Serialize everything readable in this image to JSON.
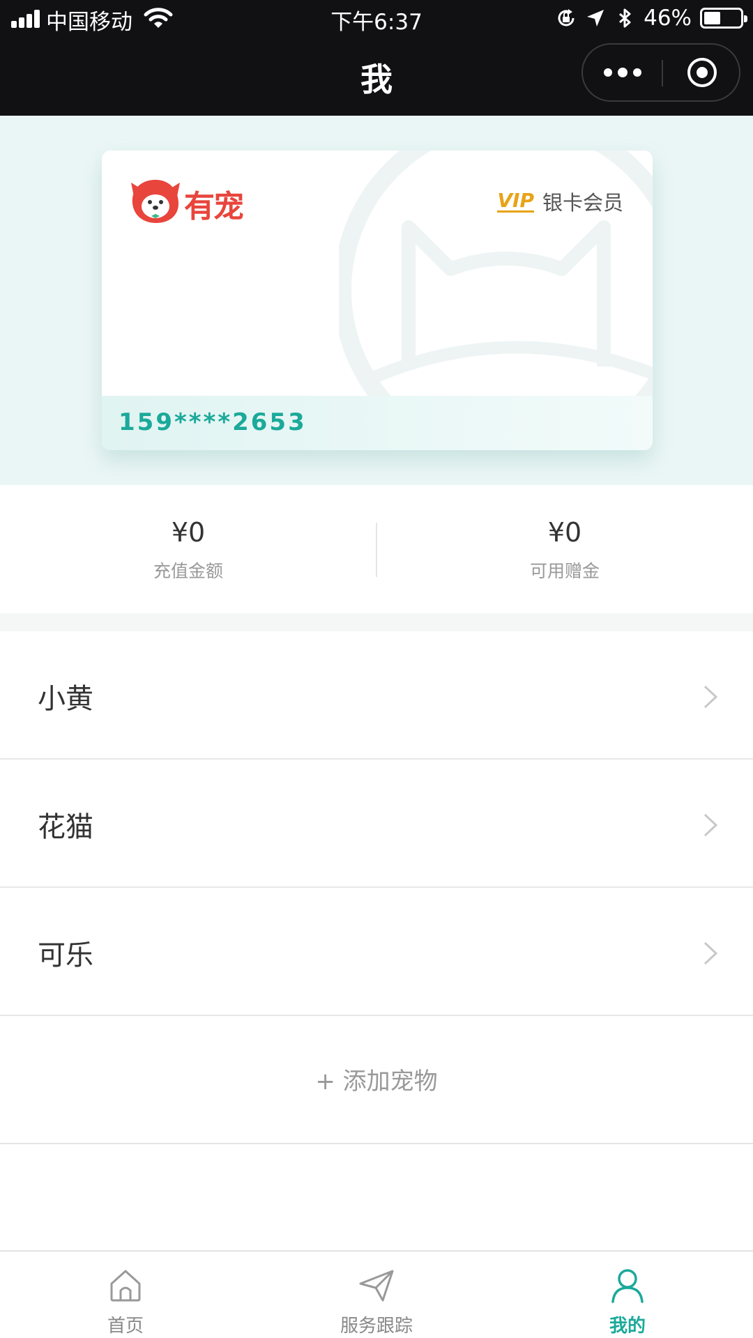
{
  "status_bar": {
    "carrier": "中国移动",
    "time": "下午6:37",
    "battery_percent": "46%",
    "battery_level": 0.46,
    "icons": [
      "signal-icon",
      "wifi-icon",
      "orientation-lock-icon",
      "location-icon",
      "bluetooth-icon",
      "battery-icon"
    ]
  },
  "nav": {
    "title": "我",
    "capsule_icons": [
      "more-icon",
      "close-miniprogram-icon"
    ]
  },
  "card": {
    "brand": "有宠",
    "vip_mark": "VIP",
    "member_level": "银卡会员",
    "number": "159****2653",
    "colors": {
      "brand": "#e8453c",
      "vip": "#e8a317",
      "accent": "#1ba99a"
    }
  },
  "balances": [
    {
      "value": "¥0",
      "label": "充值金额"
    },
    {
      "value": "¥0",
      "label": "可用赠金"
    }
  ],
  "pets": [
    {
      "name": "小黄"
    },
    {
      "name": "花猫"
    },
    {
      "name": "可乐"
    }
  ],
  "add_pet_label": "+ 添加宠物",
  "tabs": [
    {
      "label": "首页",
      "icon": "home-icon",
      "active": false
    },
    {
      "label": "服务跟踪",
      "icon": "send-icon",
      "active": false
    },
    {
      "label": "我的",
      "icon": "user-icon",
      "active": true
    }
  ]
}
